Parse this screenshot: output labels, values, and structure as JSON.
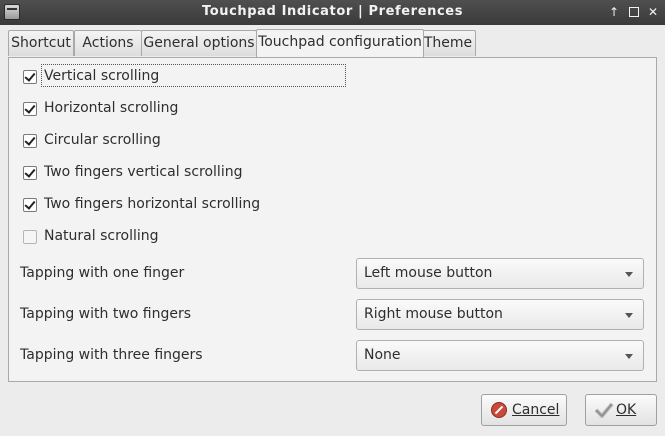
{
  "window": {
    "title": "Touchpad Indicator | Preferences"
  },
  "tabs": [
    {
      "label": "Shortcut"
    },
    {
      "label": "Actions"
    },
    {
      "label": "General options"
    },
    {
      "label": "Touchpad configuration",
      "active": true
    },
    {
      "label": "Theme"
    }
  ],
  "checkboxes": [
    {
      "label": "Vertical scrolling",
      "checked": true
    },
    {
      "label": "Horizontal scrolling",
      "checked": true
    },
    {
      "label": "Circular scrolling",
      "checked": true
    },
    {
      "label": "Two fingers vertical scrolling",
      "checked": true
    },
    {
      "label": "Two fingers horizontal scrolling",
      "checked": true
    },
    {
      "label": "Natural scrolling",
      "checked": false
    }
  ],
  "tapping": [
    {
      "label": "Tapping with one finger",
      "value": "Left mouse button"
    },
    {
      "label": "Tapping with two fingers",
      "value": "Right mouse button"
    },
    {
      "label": "Tapping with three fingers",
      "value": "None"
    }
  ],
  "buttons": {
    "cancel": "Cancel",
    "ok": "OK"
  },
  "icons": {
    "app": "touchpad-app-icon",
    "cancel": "cancel-icon",
    "ok": "checkmark-icon"
  }
}
